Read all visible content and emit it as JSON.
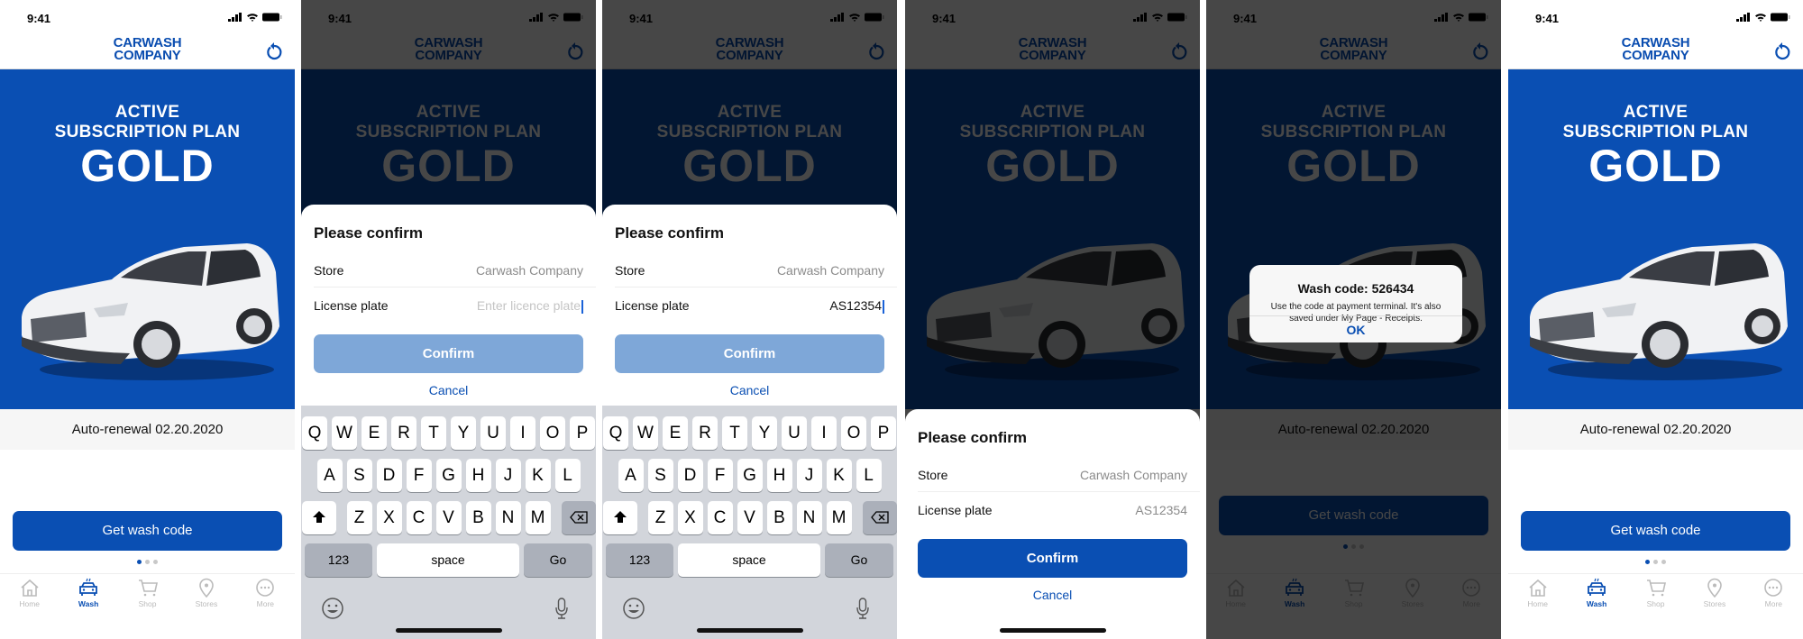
{
  "status": {
    "time": "9:41"
  },
  "app": {
    "logo_line1": "CARWASH",
    "logo_line2": "COMPANY",
    "brand_color": "#0a4fb3"
  },
  "hero": {
    "line1": "ACTIVE",
    "line2": "SUBSCRIPTION PLAN",
    "plan": "GOLD"
  },
  "renewal": "Auto-renewal 02.20.2020",
  "get_code_label": "Get wash code",
  "tabs": [
    {
      "label": "Home",
      "icon": "home-icon"
    },
    {
      "label": "Wash",
      "icon": "car-wash-icon"
    },
    {
      "label": "Shop",
      "icon": "cart-icon"
    },
    {
      "label": "Stores",
      "icon": "location-pin-icon"
    },
    {
      "label": "More",
      "icon": "more-icon"
    }
  ],
  "dialog": {
    "title": "Please confirm",
    "store_label": "Store",
    "store_value": "Carwash Company",
    "plate_label": "License plate",
    "plate_placeholder": "Enter licence plate",
    "plate_value": "AS12354",
    "confirm_label": "Confirm",
    "cancel_label": "Cancel"
  },
  "keyboard": {
    "row1": [
      "Q",
      "W",
      "E",
      "R",
      "T",
      "Y",
      "U",
      "I",
      "O",
      "P"
    ],
    "row2": [
      "A",
      "S",
      "D",
      "F",
      "G",
      "H",
      "J",
      "K",
      "L"
    ],
    "row3": [
      "Z",
      "X",
      "C",
      "V",
      "B",
      "N",
      "M"
    ],
    "numbers": "123",
    "space": "space",
    "go": "Go"
  },
  "alert": {
    "title": "Wash code: 526434",
    "message": "Use the code at payment terminal. It's also saved under My Page - Receipts.",
    "ok_label": "OK"
  }
}
